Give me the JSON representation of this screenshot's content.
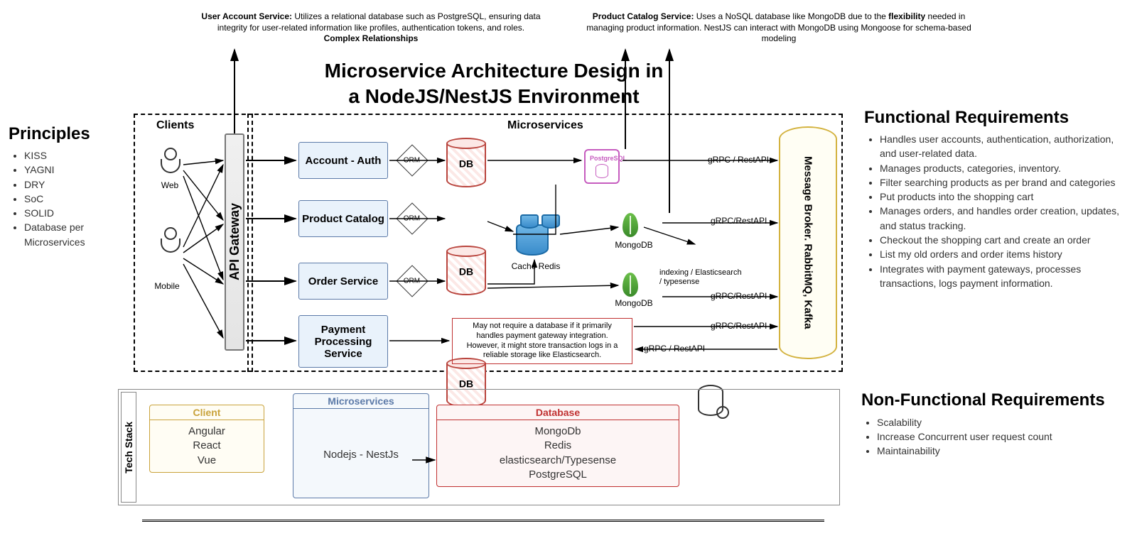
{
  "title_l1": "Microservice Architecture Design in",
  "title_l2": "a NodeJS/NestJS Environment",
  "callout_left": {
    "lead": "User Account Service:",
    "text": " Utilizes a relational database such as PostgreSQL, ensuring data integrity for user-related information like profiles, authentication tokens, and roles.",
    "tag": "Complex Relationships"
  },
  "callout_right": {
    "lead": "Product Catalog Service:",
    "text1": " Uses a NoSQL database like MongoDB due to the ",
    "bold": "flexibility",
    "text2": " needed in managing product information. NestJS can interact with MongoDB using Mongoose for schema-based modeling"
  },
  "principles": {
    "header": "Principles",
    "items": [
      "KISS",
      "YAGNI",
      "DRY",
      "SoC",
      "SOLID",
      "Database per Microservices"
    ]
  },
  "clients_label": "Clients",
  "microservices_label": "Microservices",
  "client_web": "Web",
  "client_mobile": "Mobile",
  "api_gateway": "API Gateway",
  "svc": {
    "account": "Account - Auth",
    "catalog": "Product Catalog",
    "order": "Order Service",
    "payment": "Payment Processing Service"
  },
  "orm": "ORM",
  "db_label": "DB",
  "redis_label": "Cache Redis",
  "mongo_label": "MongoDB",
  "postgres_label": "PostgreSQL",
  "es_indexing_l1": "indexing / Elasticsearch",
  "es_indexing_l2": "/ typesense",
  "broker": "Message Broker. RabbitMQ, Kafka",
  "grpc": "gRPC / RestAPI",
  "grpc2": "gRPC/RestAPI",
  "payment_note_l1": "May not require a database if it primarily",
  "payment_note_l2": "handles payment gateway integration.",
  "payment_note_l3": "However, it might store transaction logs in a",
  "payment_note_l4": "reliable storage like Elasticsearch.",
  "fr": {
    "header": "Functional Requirements",
    "items": [
      "Handles user accounts, authentication, authorization, and user-related data.",
      "Manages products, categories, inventory.",
      "Filter searching products as per brand and categories",
      "Put products into the shopping cart",
      "Manages orders, and handles order creation, updates, and status tracking.",
      "Checkout the shopping cart and create an order",
      "List my old orders and order items history",
      "Integrates with payment gateways, processes transactions, logs payment information."
    ]
  },
  "nfr": {
    "header": "Non-Functional Requirements",
    "items": [
      "Scalability",
      "Increase Concurrent user request count",
      "Maintainability"
    ]
  },
  "tech_stack_label": "Tech Stack",
  "tech": {
    "client": {
      "title": "Client",
      "items": [
        "Angular",
        "React",
        "Vue"
      ]
    },
    "micro": {
      "title": "Microservices",
      "body": "Nodejs - NestJs"
    },
    "db": {
      "title": "Database",
      "items": [
        "MongoDb",
        "Redis",
        "elasticsearch/Typesense",
        "PostgreSQL"
      ]
    }
  }
}
